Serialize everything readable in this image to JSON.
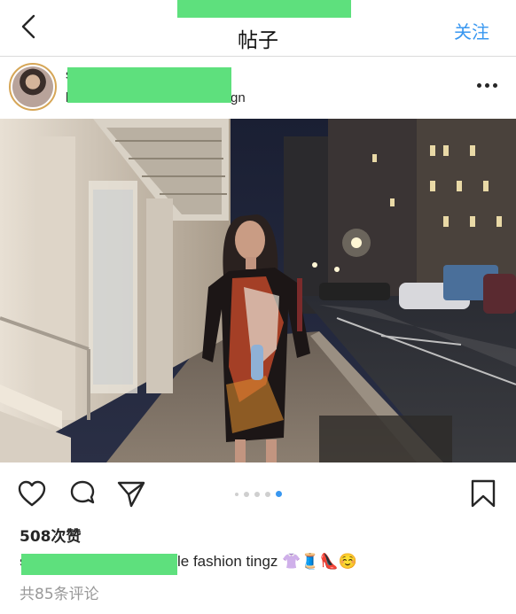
{
  "nav": {
    "title": "帖子",
    "follow_label": "关注",
    "back_icon": "chevron-left-icon"
  },
  "post": {
    "username_first_char": "s",
    "location_first_char": "l",
    "location_suffix": "gn",
    "more_icon": "more-horizontal-icon",
    "likes_label": "508次赞",
    "caption_user_first_char": "s",
    "caption_text": "le fashion tingz 👚🧵👠☺️",
    "comments_label": "共85条评论",
    "carousel": {
      "total": 5,
      "active_index": 4
    }
  },
  "colors": {
    "accent_blue": "#3897f0",
    "redaction_green": "#5ee07d",
    "avatar_ring": "#d6a657"
  }
}
